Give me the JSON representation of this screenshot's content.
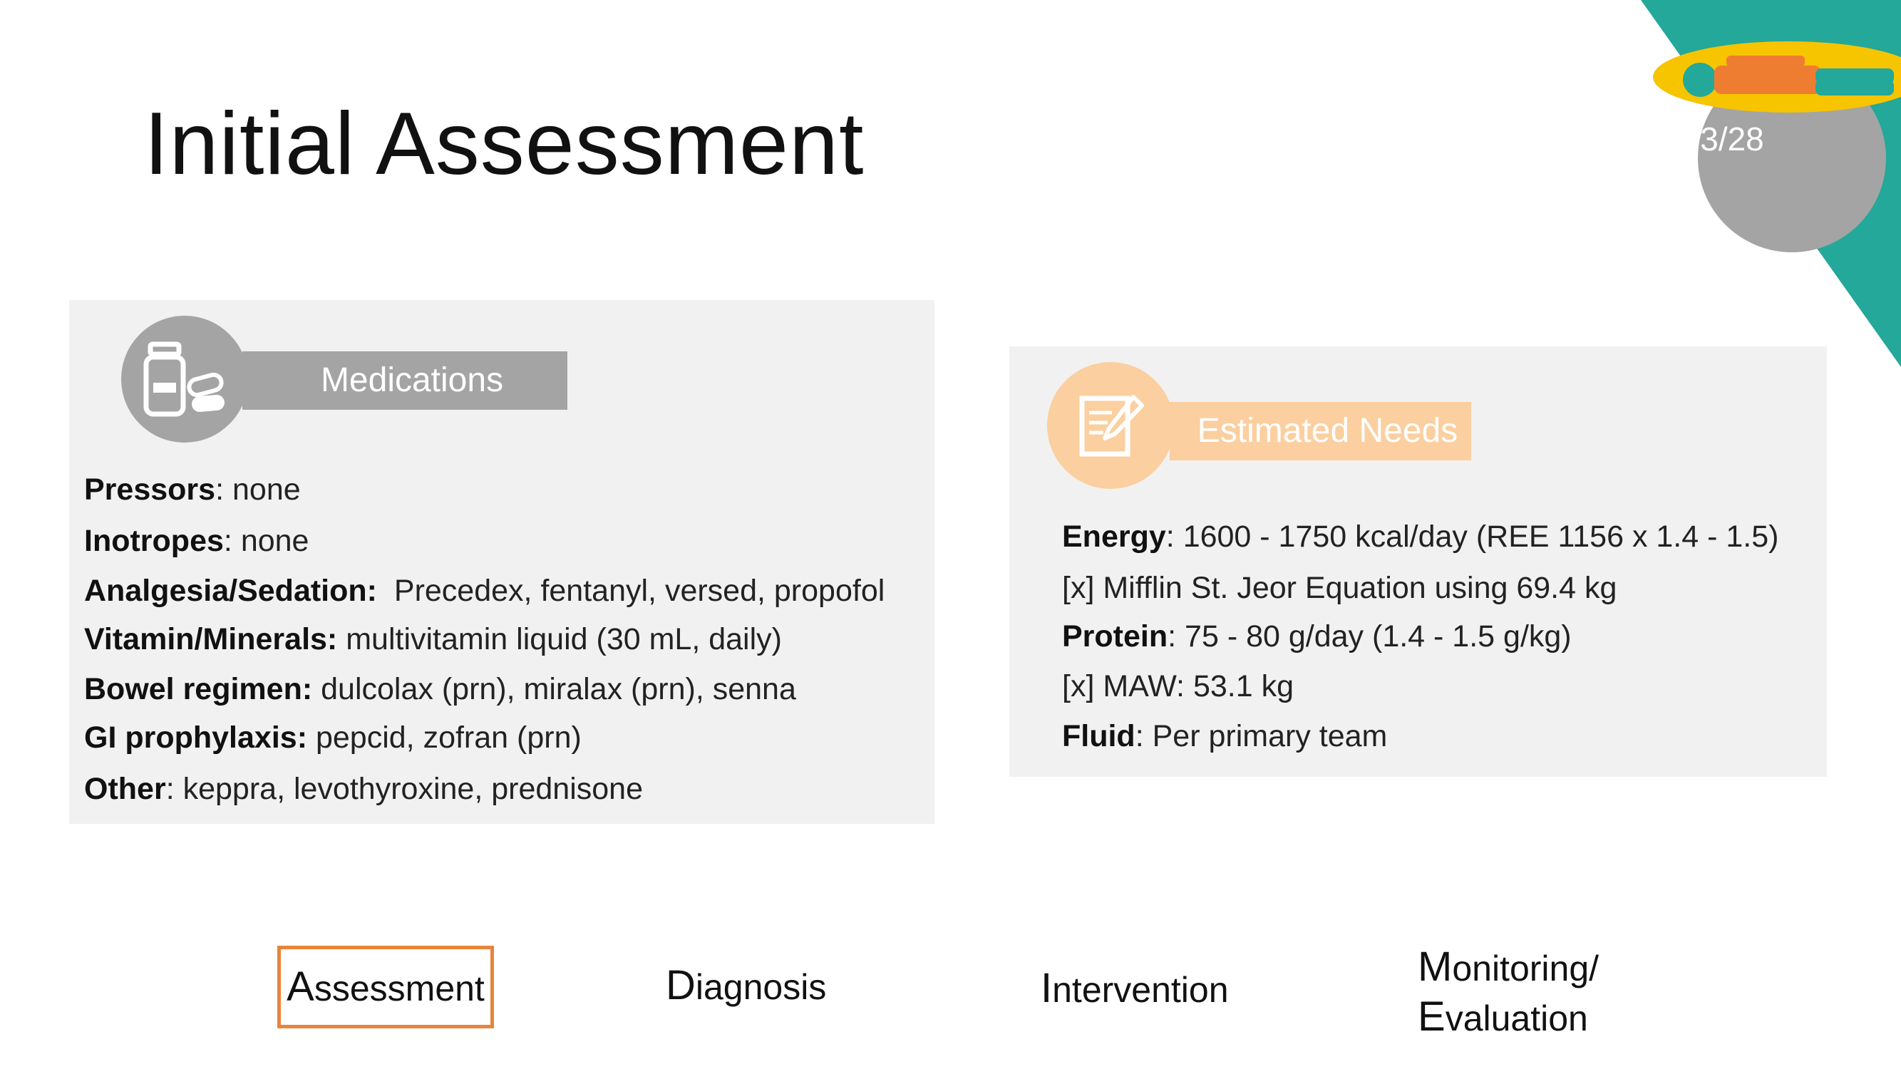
{
  "slide": {
    "title": "Initial Assessment",
    "page": "3/28"
  },
  "colors": {
    "teal": "#23a89a",
    "yellow": "#f7c400",
    "orange_figure": "#ef7d31",
    "gray_circle": "#a4a4a4",
    "peach": "#fbcfa0",
    "panel_bg": "#f1f1f1",
    "nav_highlight": "#e8843c"
  },
  "medications": {
    "header": "Medications",
    "icon": "medicine-bottle-pills-icon",
    "items": [
      {
        "key": "Pressors",
        "sep": ": ",
        "value": "none"
      },
      {
        "key": "Inotropes",
        "sep": ": ",
        "value": "none"
      },
      {
        "key": "Analgesia/Sedation:",
        "sep": "  ",
        "value": "Precedex, fentanyl, versed, propofol"
      },
      {
        "key": "Vitamin/Minerals:",
        "sep": " ",
        "value": "multivitamin liquid (30 mL, daily)"
      },
      {
        "key": "Bowel regimen:",
        "sep": " ",
        "value": "dulcolax (prn), miralax (prn), senna"
      },
      {
        "key": "GI prophylaxis:",
        "sep": " ",
        "value": "pepcid, zofran (prn)"
      },
      {
        "key": "Other",
        "sep": ": ",
        "value": "keppra, levothyroxine, prednisone"
      }
    ]
  },
  "estimated_needs": {
    "header": "Estimated Needs",
    "icon": "notepad-pencil-icon",
    "items": [
      {
        "key": "Energy",
        "sep": ": ",
        "value": "1600 - 1750 kcal/day (REE 1156 x 1.4 - 1.5)"
      },
      {
        "key": "",
        "sep": "",
        "value": "[x] Mifflin St. Jeor Equation using 69.4 kg"
      },
      {
        "key": "Protein",
        "sep": ": ",
        "value": "75 - 80 g/day (1.4 - 1.5 g/kg)"
      },
      {
        "key": "",
        "sep": "",
        "value": "[x] MAW: 53.1 kg"
      },
      {
        "key": "Fluid",
        "sep": ": ",
        "value": "Per primary team"
      }
    ]
  },
  "nav": {
    "assessment": {
      "first": "A",
      "rest": "ssessment",
      "active": true
    },
    "diagnosis": {
      "first": "D",
      "rest": "iagnosis"
    },
    "intervention": {
      "first": "I",
      "rest": "ntervention"
    },
    "monitoring": {
      "first": "M",
      "rest": "onitoring/"
    },
    "evaluation": {
      "first": "E",
      "rest": "valuation"
    }
  }
}
